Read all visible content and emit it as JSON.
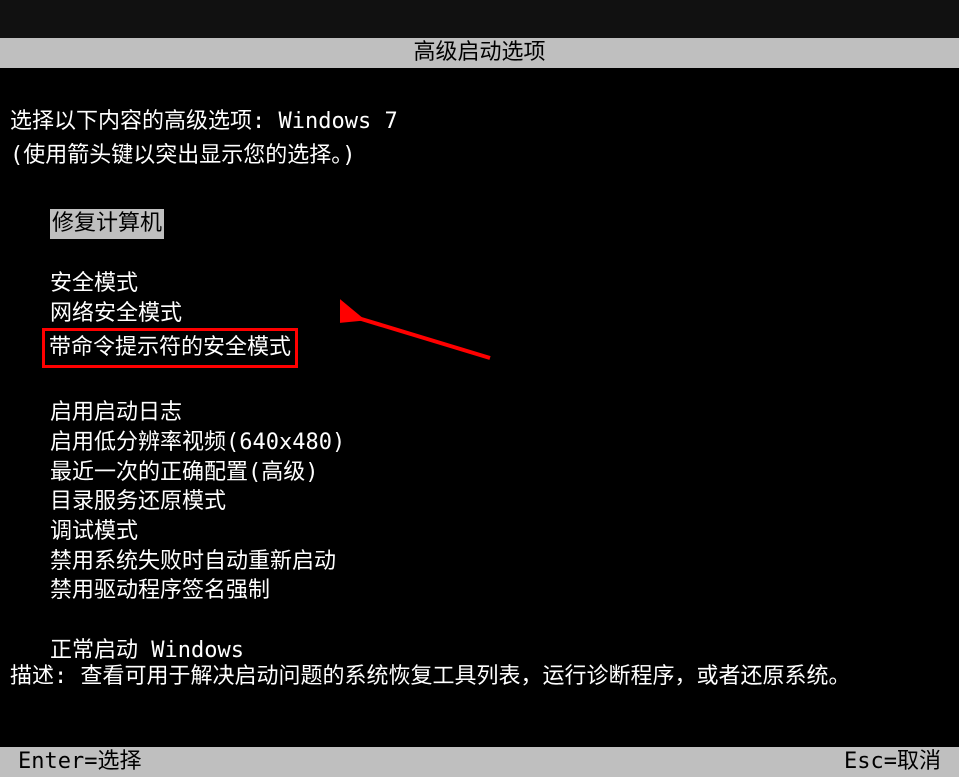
{
  "title": "高级启动选项",
  "prompt_prefix": "选择以下内容的高级选项: ",
  "os_name": "Windows 7",
  "hint": "(使用箭头键以突出显示您的选择。)",
  "menu": {
    "repair": "修复计算机",
    "safe_mode": "安全模式",
    "safe_mode_network": "网络安全模式",
    "safe_mode_cmd": "带命令提示符的安全模式",
    "boot_log": "启用启动日志",
    "low_res": "启用低分辨率视频(640x480)",
    "last_known": "最近一次的正确配置(高级)",
    "ds_restore": "目录服务还原模式",
    "debug": "调试模式",
    "no_restart": "禁用系统失败时自动重新启动",
    "no_driver_sig": "禁用驱动程序签名强制",
    "normal": "正常启动 Windows"
  },
  "description_label": "描述: ",
  "description_text": "查看可用于解决启动问题的系统恢复工具列表，运行诊断程序，或者还原系统。",
  "footer": {
    "enter": "Enter=选择",
    "esc": "Esc=取消"
  }
}
